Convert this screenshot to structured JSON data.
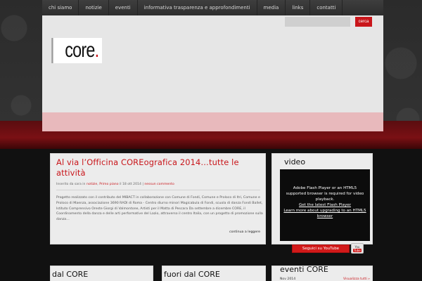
{
  "nav": {
    "items": [
      "chi siamo",
      "notizie",
      "eventi",
      "informativa trasparenza e approfondimenti",
      "media",
      "links",
      "contatti"
    ]
  },
  "header": {
    "search_button": "cerca",
    "logo_text": "core",
    "logo_dot": "."
  },
  "post": {
    "title": "Al via l’Officina COREografica 2014…tutte le attività",
    "meta_prefix": "Inserito da sara in ",
    "meta_cat1": "notizie",
    "meta_sep": ", ",
    "meta_cat2": "Primo piano",
    "meta_date": " il 18 ott 2014 | ",
    "meta_comments": "nessun commento",
    "excerpt": "Progetto realizzato con il contributo del MIBACT in collaborazione con Comune di Fondi, Comune e Proloco di Itri, Comune e Proloco di Maenza, associazione 3690 RADI di Roma - Centro diurno minori Magicabula di Fondi, scuola di danza Fondi Ballet, Istituto Comprensivo Oreste Giorgi di Valmontone, Artisti per il Matta di Pescara Da settembre a dicembre CORE, il Coordinamento della danza e delle arti performative del Lazio, attraverso il centro Italia, con un progetto di promozione sulla danza…",
    "read_more": "continua a leggere"
  },
  "sidebar": {
    "title": "video",
    "flash_line1": "Adobe Flash Player or an HTML5 supported browser is required for video playback.",
    "flash_link1": "Get the latest Flash Player",
    "flash_link2": "Learn more about upgrading to an HTML5 browser",
    "youtube_label": "Seguici su YouTube",
    "youtube_icon_you": "You",
    "youtube_icon_tube": "Tube"
  },
  "lower": {
    "panel1_title": "dal CORE",
    "panel2_title": "fuori dal CORE",
    "panel3_title": "eventi CORE",
    "event_date": "Nov 2014",
    "event_link": "Visualizza tutti »"
  },
  "colors": {
    "accent": "#c9161b",
    "nav_bg": "#333333",
    "header_bg": "#e6e6e6",
    "pink_bar": "#e8b9bc"
  }
}
